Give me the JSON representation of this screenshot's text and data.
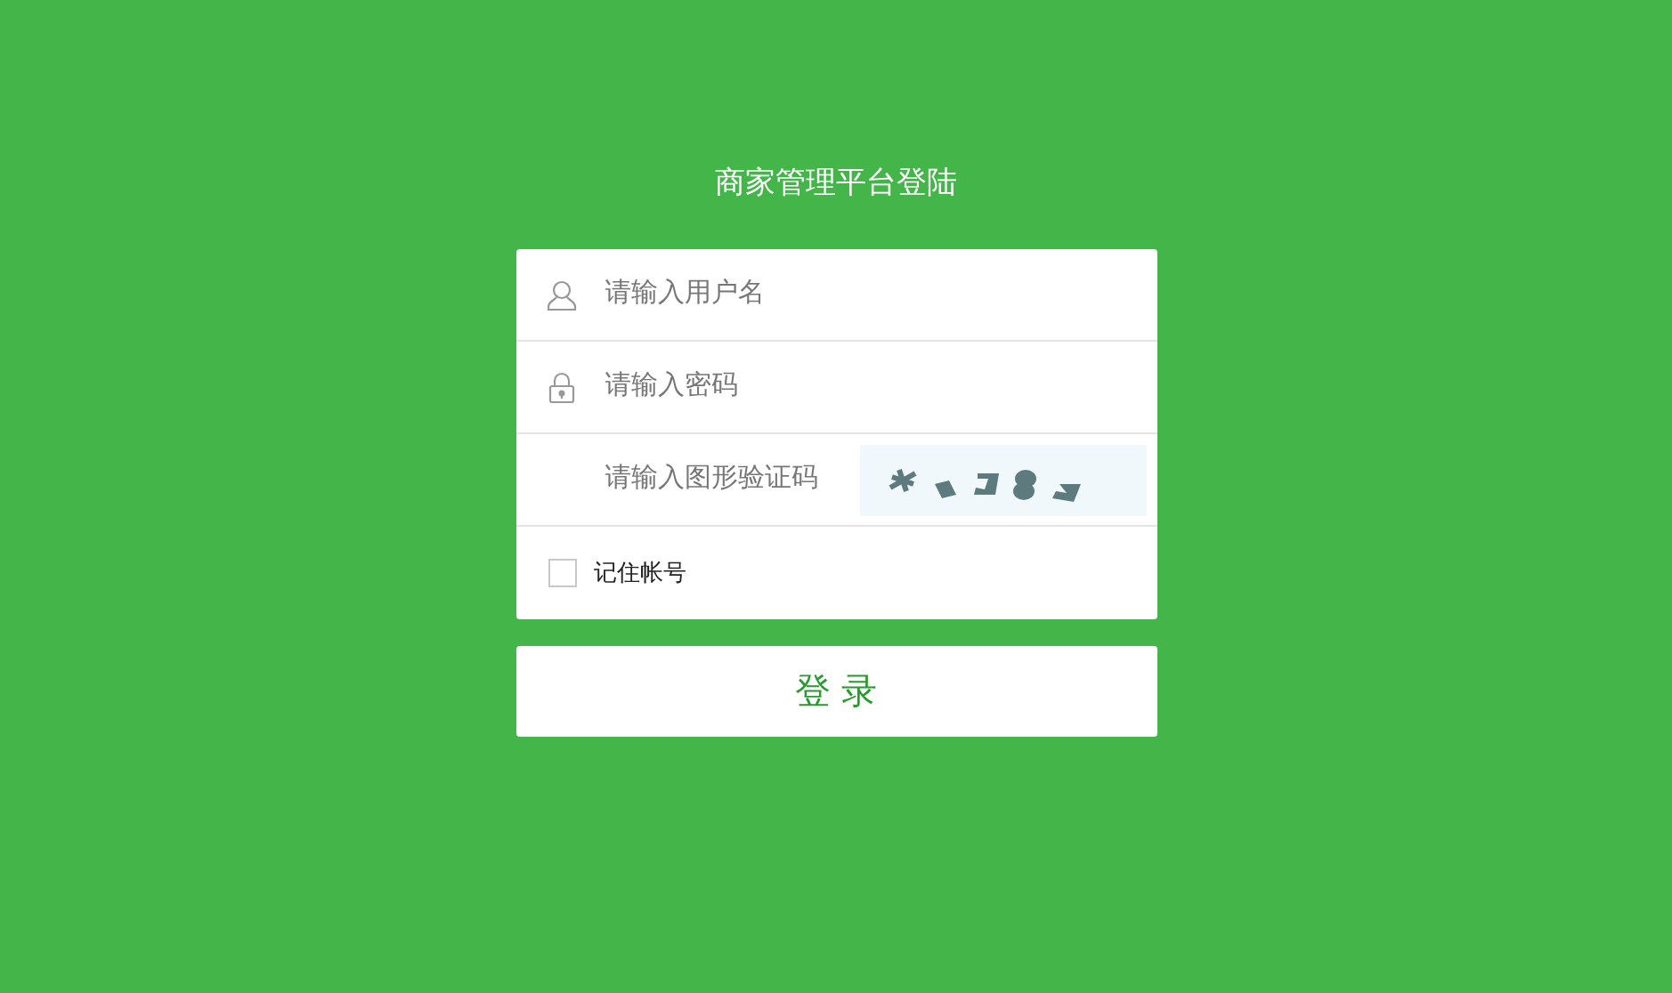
{
  "title": "商家管理平台登陆",
  "fields": [
    {
      "kind": "username",
      "placeholder": "请输入用户名"
    },
    {
      "kind": "password",
      "placeholder": "请输入密码"
    },
    {
      "kind": "captcha",
      "placeholder": "请输入图形验证码"
    }
  ],
  "remember": {
    "label": "记住帐号",
    "checked": false
  },
  "login_button": "登 录"
}
